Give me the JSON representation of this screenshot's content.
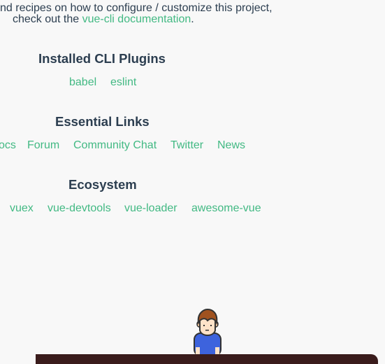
{
  "intro": {
    "line1": "nd recipes on how to configure / customize this project,",
    "line2_prefix": "check out the ",
    "line2_link": "vue-cli documentation",
    "line2_suffix": "."
  },
  "plugins": {
    "title": "Installed CLI Plugins",
    "links": [
      "babel",
      "eslint"
    ]
  },
  "essential": {
    "title": "Essential Links",
    "links": [
      "ocs",
      "Forum",
      "Community Chat",
      "Twitter",
      "News"
    ]
  },
  "ecosystem": {
    "title": "Ecosystem",
    "links": [
      "vuex",
      "vue-devtools",
      "vue-loader",
      "awesome-vue"
    ]
  },
  "colors": {
    "text": "#2c3e50",
    "link": "#42b983",
    "bar": "#3a1c1c"
  }
}
